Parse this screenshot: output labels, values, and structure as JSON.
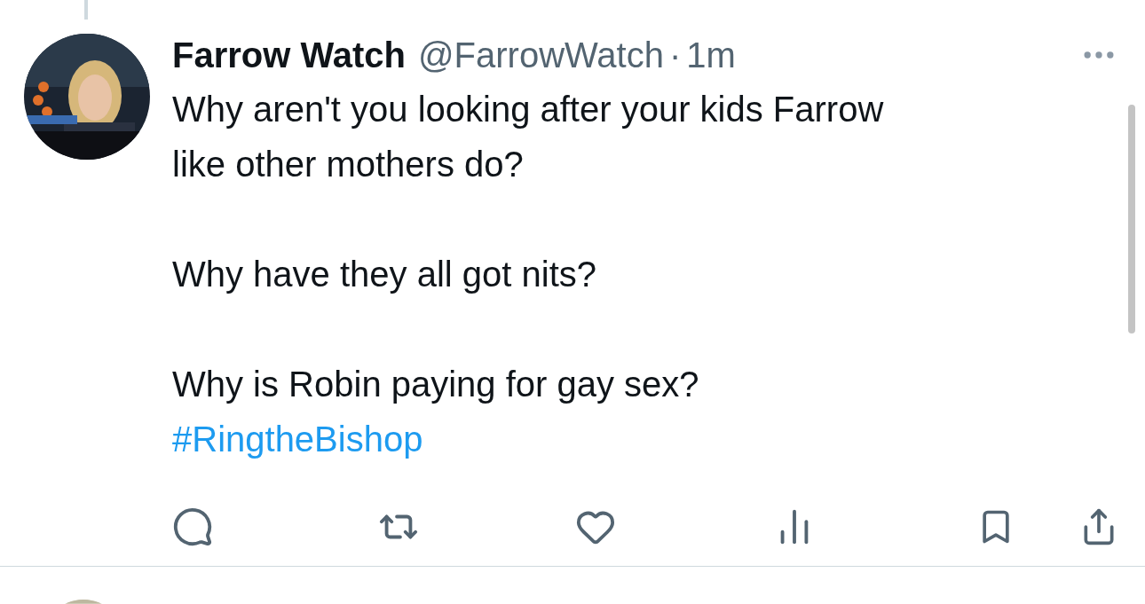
{
  "tweet": {
    "name": "Farrow Watch",
    "handle": "@FarrowWatch",
    "separator": "·",
    "time": "1m",
    "paragraphs": [
      [
        "Why aren't you looking after your kids Farrow",
        "like other mothers do?"
      ],
      [
        "Why have they all got nits?"
      ],
      [
        "Why is Robin paying for gay sex?"
      ]
    ],
    "hashtag": "#RingtheBishop"
  }
}
